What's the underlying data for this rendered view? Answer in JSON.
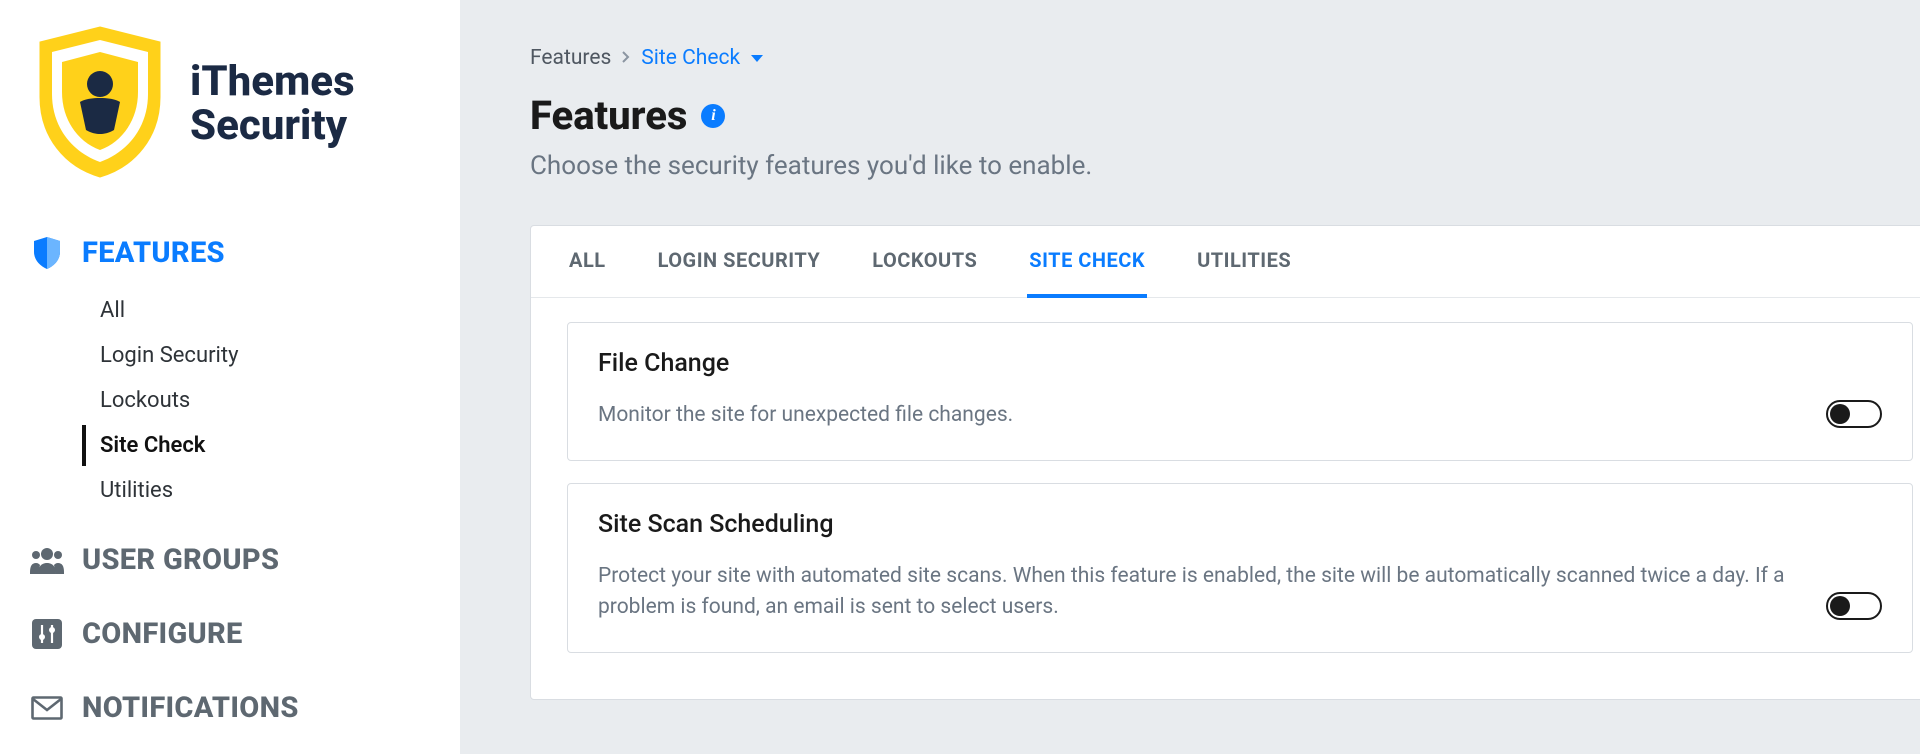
{
  "brand": {
    "line1": "iThemes",
    "line2": "Security"
  },
  "sidebar": {
    "sections": [
      {
        "label": "FEATURES",
        "active": true
      },
      {
        "label": "USER GROUPS",
        "active": false
      },
      {
        "label": "CONFIGURE",
        "active": false
      },
      {
        "label": "NOTIFICATIONS",
        "active": false
      }
    ],
    "feature_items": [
      {
        "label": "All",
        "active": false
      },
      {
        "label": "Login Security",
        "active": false
      },
      {
        "label": "Lockouts",
        "active": false
      },
      {
        "label": "Site Check",
        "active": true
      },
      {
        "label": "Utilities",
        "active": false
      }
    ]
  },
  "breadcrumb": {
    "root": "Features",
    "current": "Site Check"
  },
  "page": {
    "title": "Features",
    "subtitle": "Choose the security features you'd like to enable."
  },
  "tabs": [
    {
      "label": "ALL",
      "active": false
    },
    {
      "label": "LOGIN SECURITY",
      "active": false
    },
    {
      "label": "LOCKOUTS",
      "active": false
    },
    {
      "label": "SITE CHECK",
      "active": true
    },
    {
      "label": "UTILITIES",
      "active": false
    }
  ],
  "features": [
    {
      "title": "File Change",
      "desc": "Monitor the site for unexpected file changes.",
      "enabled": false
    },
    {
      "title": "Site Scan Scheduling",
      "desc": "Protect your site with automated site scans. When this feature is enabled, the site will be automatically scanned twice a day. If a problem is found, an email is sent to select users.",
      "enabled": false
    }
  ]
}
